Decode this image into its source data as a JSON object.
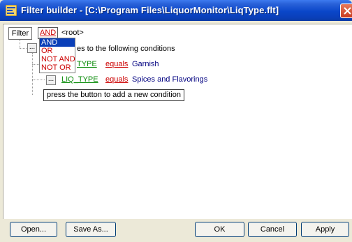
{
  "window": {
    "title": "Filter builder - [C:\\Program Files\\LiquorMonitor\\LiqType.flt]"
  },
  "toolbar": {
    "filter_label": "Filter",
    "and_label": "AND",
    "root_label": "<root>"
  },
  "dropdown": {
    "options": [
      "AND",
      "OR",
      "NOT AND",
      "NOT OR"
    ],
    "selected": "AND"
  },
  "tree": {
    "group_text": "es to the following conditions",
    "conditions": [
      {
        "field": "LIQ_TYPE",
        "field_visible": "TYPE",
        "operator": "equals",
        "value": "Garnish"
      },
      {
        "field": "LIQ_TYPE",
        "field_visible": "LIQ_TYPE",
        "operator": "equals",
        "value": "Spices and Flavorings"
      }
    ],
    "add_button_label": "...",
    "tooltip": "press the button to add a new condition"
  },
  "buttons": {
    "open": "Open...",
    "save_as": "Save As...",
    "ok": "OK",
    "cancel": "Cancel",
    "apply": "Apply"
  },
  "colors": {
    "title_bar": "#0a46c9",
    "operator_red": "#cc0000",
    "field_green": "#078a07",
    "value_navy": "#000080",
    "selection_blue": "#0a3fb8"
  }
}
